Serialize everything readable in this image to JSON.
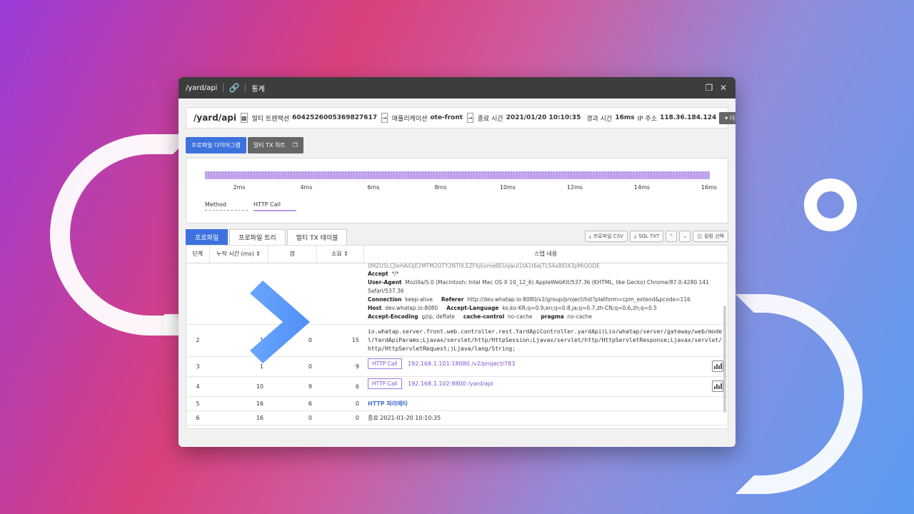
{
  "window": {
    "title": "/yard/api",
    "stat_label": "통계"
  },
  "info": {
    "path": "/yard/api",
    "multi_tx_label": "멀티 트랜잭션",
    "multi_tx_id": "6042526005369827617",
    "app_label": "애플리케이션",
    "app_name": "ote-front",
    "end_label": "종료 시간",
    "end_time": "2021/01/20 10:10:35",
    "elapsed_label": "경과 시간",
    "elapsed": "16ms",
    "ip_label": "IP 주소",
    "ip": "118.36.184.124",
    "more": "더보기"
  },
  "view_buttons": {
    "profile_diagram": "프로파일 다이어그램",
    "multi_tx_chart": "멀티 TX 차트"
  },
  "diagram": {
    "ticks": [
      "2ms",
      "4ms",
      "6ms",
      "8ms",
      "10ms",
      "12ms",
      "14ms",
      "16ms"
    ],
    "legend": [
      {
        "label": "Method",
        "color": "#999999"
      },
      {
        "label": "HTTP Call",
        "color": "#b89ae8"
      }
    ]
  },
  "tabs": [
    "프로파일",
    "프로파일 트리",
    "멀티 TX 테이블"
  ],
  "tools": {
    "csv": "프로파일 CSV",
    "sql": "SQL TXT",
    "cols": "컬럼 선택"
  },
  "table": {
    "headers": [
      "단계",
      "누적 시간 (ms)",
      "갭",
      "소요",
      "스텝 내용"
    ],
    "header_block": {
      "cut_line": "0MZU5LCJleHAiOjE2MTM2OTY2NTl9.EZFbjlixmeBEUqwuI1tA1t6ejTLS4a8IDX3pMiQODE",
      "accept_k": "Accept",
      "accept_v": "*/*",
      "ua_k": "User-Agent",
      "ua_v": "Mozilla/5.0 (Macintosh; Intel Mac OS X 10_12_6) AppleWebKit/537.36 (KHTML, like Gecko) Chrome/87.0.4280.141 Safari/537.36",
      "conn_k": "Connection",
      "conn_v": "keep-alive",
      "ref_k": "Referer",
      "ref_v": "http://dev.whatap.io:8080/v2/group/project/list?platform=cpm_extend&pcode=116",
      "host_k": "Host",
      "host_v": "dev.whatap.io:8080",
      "lang_k": "Accept-Language",
      "lang_v": "ko,ko-KR;q=0.9,en;q=0.8,ja;q=0.7,zh-CN;q=0.6,zh;q=0.5",
      "enc_k": "Accept-Encoding",
      "enc_v": "gzip, deflate",
      "cache_k": "cache-control",
      "cache_v": "no-cache",
      "pragma_k": "pragma",
      "pragma_v": "no-cache"
    },
    "rows": [
      {
        "step": "2",
        "cum": "1",
        "gap": "0",
        "dur": "15",
        "content": "io.whatap.server.front.web.controller.rest.YardApiController.yardApi(Lio/whatap/server/gateway/web/model/YardApiParams;Ljavax/servlet/http/HttpSession;Ljavax/servlet/http/HttpServletResponse;Ljavax/servlet/http/HttpServletRequest;)Ljava/lang/String;"
      },
      {
        "step": "3",
        "cum": "1",
        "gap": "0",
        "dur": "9",
        "badge": "HTTP Call",
        "ip": "192.168.1.101:18080",
        "path": "/v2/project/783"
      },
      {
        "step": "4",
        "cum": "10",
        "gap": "9",
        "dur": "6",
        "badge": "HTTP Call",
        "ip": "192.168.1.102:8800",
        "path": "/yard/api"
      },
      {
        "step": "5",
        "cum": "16",
        "gap": "6",
        "dur": "0",
        "content": "HTTP 파라메타"
      },
      {
        "step": "6",
        "cum": "16",
        "gap": "0",
        "dur": "0",
        "content": "종료 2021-01-20 10:10:35"
      }
    ]
  }
}
